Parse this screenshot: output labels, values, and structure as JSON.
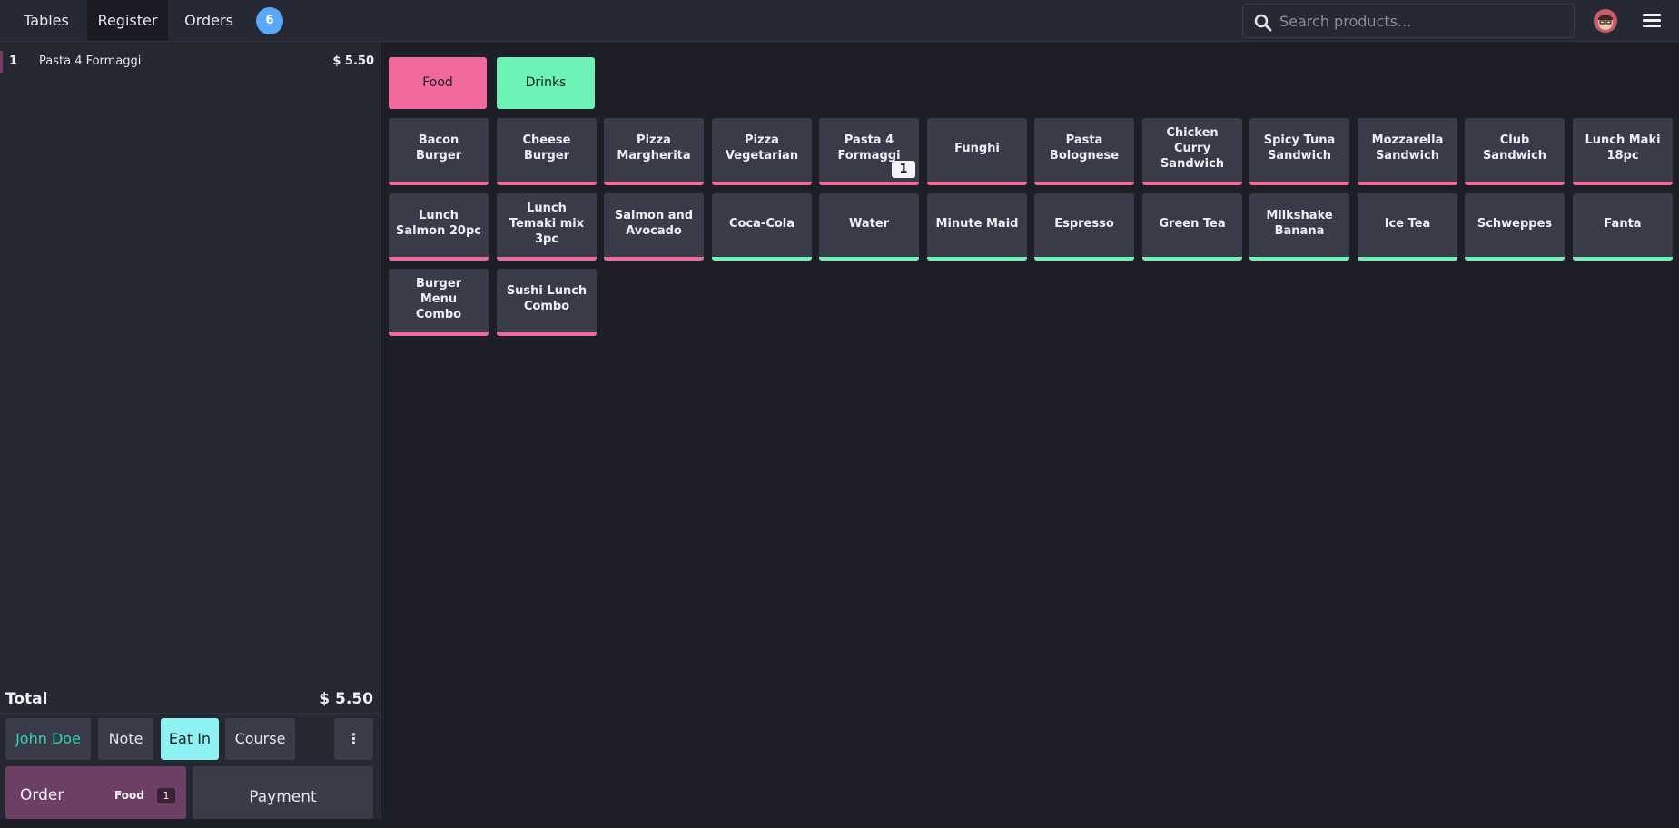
{
  "topbar": {
    "tabs": [
      {
        "label": "Tables"
      },
      {
        "label": "Register"
      },
      {
        "label": "Orders"
      }
    ],
    "orders_badge": "6",
    "search_placeholder": "Search products..."
  },
  "order": {
    "lines": [
      {
        "qty": "1",
        "name": "Pasta 4 Formaggi",
        "price": "$ 5.50"
      }
    ],
    "total_label": "Total",
    "total_amount": "$ 5.50"
  },
  "controls": {
    "customer": "John Doe",
    "note": "Note",
    "eat_in": "Eat In",
    "course": "Course",
    "more": "⋮"
  },
  "actions": {
    "order_label": "Order",
    "order_category": "Food",
    "order_count": "1",
    "payment_label": "Payment"
  },
  "categories": [
    {
      "label": "Food",
      "color": "#f06a9e"
    },
    {
      "label": "Drinks",
      "color": "#6cf2b5"
    }
  ],
  "products": [
    {
      "name": "Bacon Burger",
      "category": "food"
    },
    {
      "name": "Cheese Burger",
      "category": "food"
    },
    {
      "name": "Pizza Margherita",
      "category": "food"
    },
    {
      "name": "Pizza Vegetarian",
      "category": "food"
    },
    {
      "name": "Pasta 4 Formaggi",
      "category": "food",
      "in_order": "1"
    },
    {
      "name": "Funghi",
      "category": "food"
    },
    {
      "name": "Pasta Bolognese",
      "category": "food"
    },
    {
      "name": "Chicken Curry Sandwich",
      "category": "food"
    },
    {
      "name": "Spicy Tuna Sandwich",
      "category": "food"
    },
    {
      "name": "Mozzarella Sandwich",
      "category": "food"
    },
    {
      "name": "Club Sandwich",
      "category": "food"
    },
    {
      "name": "Lunch Maki 18pc",
      "category": "food"
    },
    {
      "name": "Lunch Salmon 20pc",
      "category": "food"
    },
    {
      "name": "Lunch Temaki mix 3pc",
      "category": "food"
    },
    {
      "name": "Salmon and Avocado",
      "category": "food"
    },
    {
      "name": "Coca-Cola",
      "category": "drink"
    },
    {
      "name": "Water",
      "category": "drink"
    },
    {
      "name": "Minute Maid",
      "category": "drink"
    },
    {
      "name": "Espresso",
      "category": "drink"
    },
    {
      "name": "Green Tea",
      "category": "drink"
    },
    {
      "name": "Milkshake Banana",
      "category": "drink"
    },
    {
      "name": "Ice Tea",
      "category": "drink"
    },
    {
      "name": "Schweppes",
      "category": "drink"
    },
    {
      "name": "Fanta",
      "category": "drink"
    },
    {
      "name": "Burger Menu Combo",
      "category": "food"
    },
    {
      "name": "Sushi Lunch Combo",
      "category": "food"
    }
  ]
}
